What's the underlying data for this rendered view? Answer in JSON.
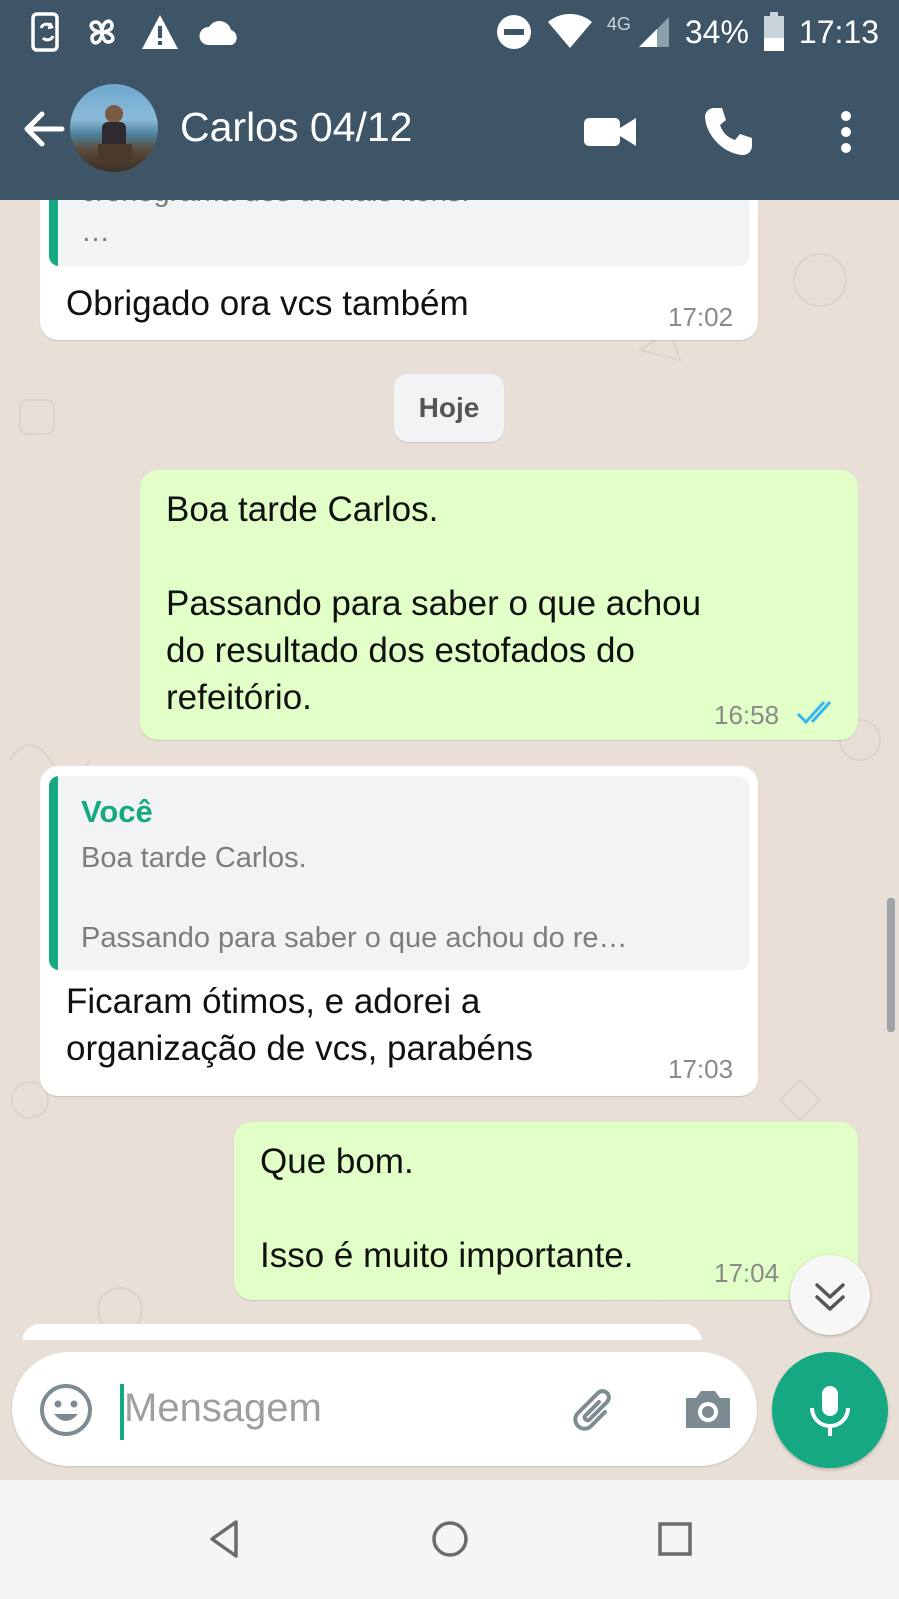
{
  "status_bar": {
    "network": "4G",
    "battery": "34%",
    "time": "17:13",
    "icons": [
      "device-sync-icon",
      "pinwheel-icon",
      "warning-icon",
      "cloud-icon",
      "do-not-disturb-icon",
      "wifi-icon",
      "cell-signal-icon",
      "battery-icon"
    ]
  },
  "header": {
    "contact_name": "Carlos 04/12",
    "icons": [
      "back-arrow-icon",
      "video-call-icon",
      "phone-icon",
      "more-vert-icon"
    ]
  },
  "messages": [
    {
      "direction": "in",
      "partial_quote_text": "cronograma dos demais itens.\n…",
      "text": "Obrigado ora vcs também",
      "time": "17:02"
    },
    {
      "type": "date",
      "label": "Hoje"
    },
    {
      "direction": "out",
      "text": "Boa tarde Carlos.\n\nPassando para saber o que achou\ndo resultado dos estofados do\nrefeitório.",
      "time": "16:58",
      "status": "read"
    },
    {
      "direction": "in",
      "quote": {
        "author": "Você",
        "text": "Boa tarde Carlos.\n\nPassando para saber o que achou do re…"
      },
      "text": "Ficaram ótimos, e adorei a\norganização de vcs, parabéns",
      "time": "17:03"
    },
    {
      "direction": "out",
      "text": "Que bom.\n\nIsso é muito importante.",
      "time": "17:04",
      "status": "delivered"
    }
  ],
  "composer": {
    "placeholder": "Mensagem"
  },
  "colors": {
    "header": "#3d5566",
    "accent": "#15a882",
    "outgoing_bubble": "#e1ffc7",
    "incoming_bubble": "#ffffff",
    "read_ticks": "#34b7f1"
  }
}
